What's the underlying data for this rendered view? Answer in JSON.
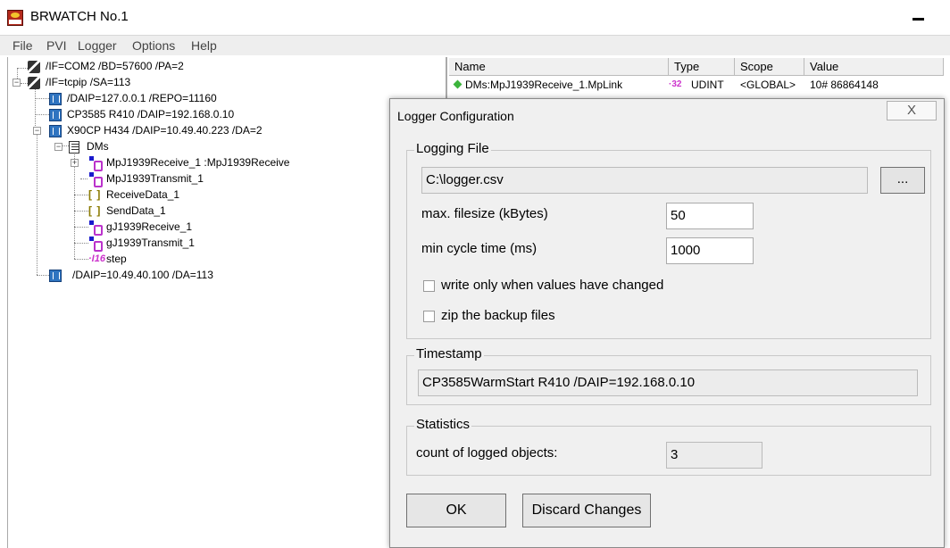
{
  "window": {
    "title": "BRWATCH No.1"
  },
  "menu": [
    "File",
    "PVI",
    "Logger",
    "Options",
    "Help"
  ],
  "tree": {
    "if_com2": "/IF=COM2 /BD=57600 /PA=2",
    "if_tcpip": "/IF=tcpip /SA=113",
    "daip_local": "/DAIP=127.0.0.1 /REPO=11160",
    "cp3585": "CP3585 R410 /DAIP=192.168.0.10",
    "x90cp": "X90CP H434 /DAIP=10.49.40.223 /DA=2",
    "dms": "DMs",
    "mp_receive": "MpJ1939Receive_1  :MpJ1939Receive",
    "mp_transmit": "MpJ1939Transmit_1",
    "receive_data": "ReceiveData_1",
    "send_data": "SendData_1",
    "g_receive": "gJ1939Receive_1",
    "g_transmit": "gJ1939Transmit_1",
    "step": "step",
    "daip_113": "/DAIP=10.49.40.100 /DA=113",
    "arr_icon_text": "[ ]",
    "i16_icon_text": "·I16"
  },
  "list": {
    "headers": {
      "name": "Name",
      "type": "Type",
      "scope": "Scope",
      "value": "Value"
    },
    "row1": {
      "name": "DMs:MpJ1939Receive_1.MpLink",
      "badge": "·32",
      "type": "UDINT",
      "scope": "<GLOBAL>",
      "value": "10# 86864148"
    }
  },
  "dialog": {
    "title": "Logger Configuration",
    "close_glyph": "X",
    "logging_group": "Logging File",
    "file_path": "C:\\logger.csv",
    "browse_label": "...",
    "filesize_label": "max. filesize (kBytes)",
    "filesize_value": "50",
    "cycle_label": "min cycle time (ms)",
    "cycle_value": "1000",
    "write_only_label": "write only when values have changed",
    "write_only_checked": false,
    "zip_label": "zip the backup files",
    "zip_checked": false,
    "timestamp_group": "Timestamp",
    "timestamp_value": "CP3585WarmStart R410 /DAIP=192.168.0.10",
    "statistics_group": "Statistics",
    "count_label": "count of logged objects:",
    "count_value": "3",
    "ok_label": "OK",
    "discard_label": "Discard Changes"
  },
  "colors": {
    "tree_struct": "#1a1acc",
    "tree_arr": "#8a7a00",
    "badge_magenta": "#cc33cc",
    "status_green": "#3cb43c"
  }
}
